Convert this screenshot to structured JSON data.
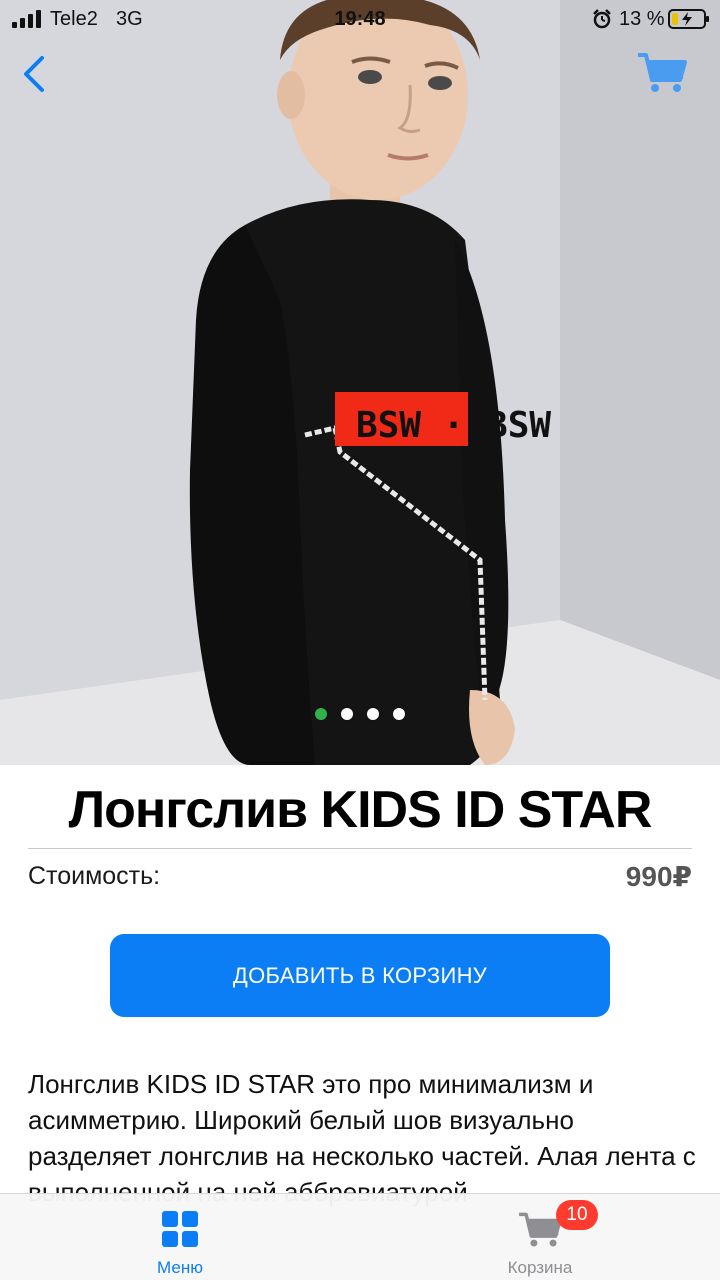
{
  "status_bar": {
    "carrier": "Tele2",
    "network": "3G",
    "time": "19:48",
    "battery_percent": "13 %"
  },
  "nav": {
    "back_icon": "chevron-left-icon",
    "cart_icon": "cart-icon"
  },
  "product": {
    "image_print_text": "BSW · BSW",
    "title": "Лонгслив KIDS ID STAR",
    "price_label": "Стоимость:",
    "price_value": "990₽",
    "add_to_cart_label": "ДОБАВИТЬ В КОРЗИНУ",
    "description": "Лонгслив KIDS ID STAR это про минимализм и асимметрию. Широкий белый шов визуально разделяет лонгслив на несколько частей. Алая лента с выполненной на ней аббревиатурой"
  },
  "gallery": {
    "total_images": 4,
    "active_index": 0
  },
  "tabs": [
    {
      "label": "Меню",
      "icon": "grid-icon",
      "active": true
    },
    {
      "label": "Корзина",
      "icon": "cart-icon",
      "badge": "10",
      "active": false
    }
  ],
  "colors": {
    "accent": "#0b7ef6",
    "badge": "#ff3b30",
    "active_dot": "#2fb24c"
  }
}
